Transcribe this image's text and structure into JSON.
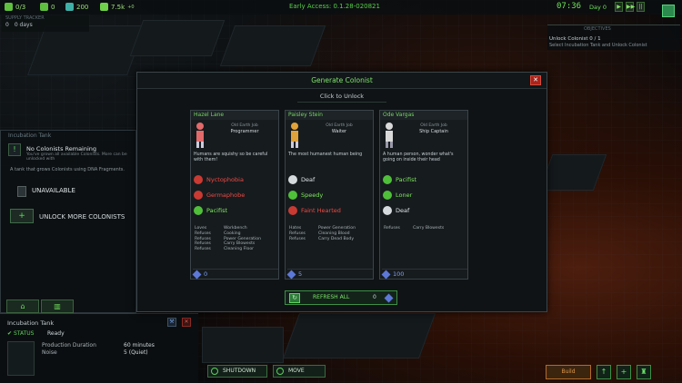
{
  "topbar": {
    "resources": [
      {
        "icon": "colonist-icon",
        "value": "0/3"
      },
      {
        "icon": "crate-icon",
        "value": "0"
      },
      {
        "icon": "credit-icon",
        "value": "200"
      },
      {
        "icon": "energy-icon",
        "value": "7.5k"
      }
    ],
    "energy_delta": "+0",
    "early_access": "Early Access: 0.1.28-020821",
    "clock": "07:36",
    "day": "Day 0",
    "speed_buttons": [
      "▶",
      "▶▶",
      "||"
    ]
  },
  "tracker": {
    "title": "SUPPLY TRACKER",
    "colonists": "0",
    "days": "0 days"
  },
  "objectives": {
    "title": "OBJECTIVES",
    "line1": "Unlock Colonist 0 / 1",
    "line2": "Select Incubation Tank and Unlock Colonist"
  },
  "left_panel": {
    "title": "Incubation Tank",
    "no_colonists": "No Colonists Remaining",
    "no_colonists_sub": "You've grown all available Colonists. More can be unlocked with",
    "description": "A tank that grows Colonists using DNA Fragments.",
    "unavailable": "UNAVAILABLE",
    "unlock_more": "UNLOCK MORE COLONISTS"
  },
  "info_panel": {
    "title": "Incubation Tank",
    "status_label": "STATUS",
    "status_value": "Ready",
    "rows": [
      {
        "label": "Production Duration",
        "value": "60 minutes"
      },
      {
        "label": "Noise",
        "value": "5 (Quiet)"
      }
    ]
  },
  "bottom_bar": {
    "shutdown": "SHUTDOWN",
    "move": "MOVE",
    "build": "Build"
  },
  "dialog": {
    "title": "Generate Colonist",
    "click_to_unlock": "Click to Unlock",
    "refresh_label": "REFRESH ALL",
    "refresh_cost": "0",
    "cards": [
      {
        "name": "Hazel Lane",
        "job_prefix": "Old Earth Job",
        "job": "Programmer",
        "quote": "Humans are squishy so be careful with them!",
        "traits": [
          {
            "name": "Nyctophobia",
            "kind": "bad",
            "icon": "moon-icon"
          },
          {
            "name": "Germaphobe",
            "kind": "bad",
            "icon": "germ-icon"
          },
          {
            "name": "Pacifist",
            "kind": "good",
            "icon": "flower-icon"
          }
        ],
        "prefs": [
          [
            "Loves",
            "Workbench"
          ],
          [
            "Refuses",
            "Cooking"
          ],
          [
            "Refuses",
            "Power Generation"
          ],
          [
            "Refuses",
            "Carry Blowests"
          ],
          [
            "Refuses",
            "Cleaning Floor"
          ]
        ],
        "cost": "0",
        "portrait_color": "#e26a6a"
      },
      {
        "name": "Paisley Stein",
        "job_prefix": "Old Earth Job",
        "job": "Waiter",
        "quote": "The most humanest human being",
        "traits": [
          {
            "name": "Deaf",
            "kind": "neutral",
            "icon": "ear-icon"
          },
          {
            "name": "Speedy",
            "kind": "good",
            "icon": "speed-icon"
          },
          {
            "name": "Faint Hearted",
            "kind": "bad",
            "icon": "heart-icon"
          }
        ],
        "prefs": [
          [
            "Hates",
            "Power Generation"
          ],
          [
            "Refuses",
            "Cleaning Blood"
          ],
          [
            "Refuses",
            "Carry Dead Body"
          ]
        ],
        "cost": "5",
        "portrait_color": "#e0a23a"
      },
      {
        "name": "Ode Vargas",
        "job_prefix": "Old Earth Job",
        "job": "Ship Captain",
        "quote": "A human person, wonder what's going on inside their head",
        "traits": [
          {
            "name": "Pacifist",
            "kind": "good",
            "icon": "flower-icon"
          },
          {
            "name": "Loner",
            "kind": "good",
            "icon": "loner-icon"
          },
          {
            "name": "Deaf",
            "kind": "neutral",
            "icon": "ear-icon"
          }
        ],
        "prefs": [
          [
            "Refuses",
            "Carry Blowests"
          ]
        ],
        "cost": "100",
        "portrait_color": "#d9d9d9"
      }
    ]
  }
}
